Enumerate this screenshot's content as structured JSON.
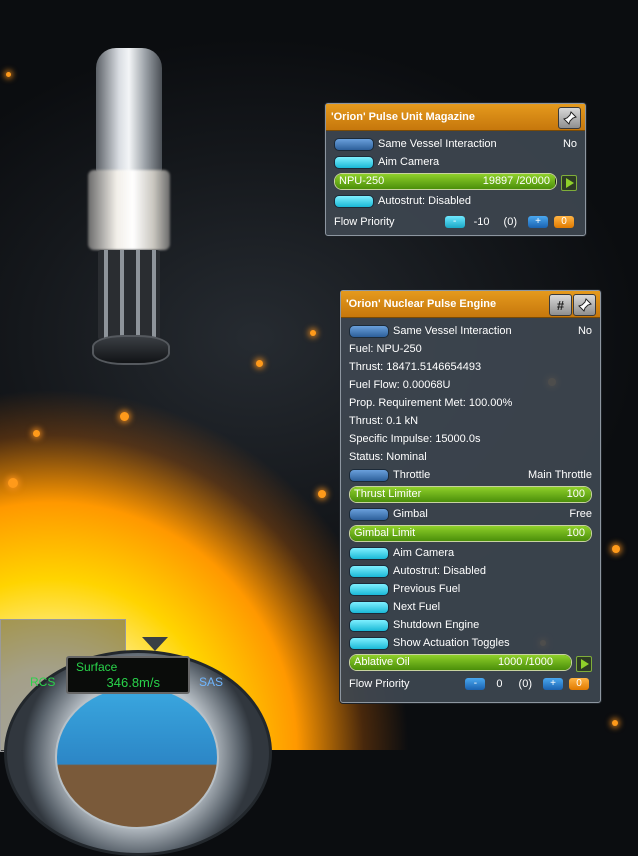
{
  "magazine": {
    "title": "'Orion' Pulse Unit Magazine",
    "pin_icon": "pin-icon",
    "same_vessel": {
      "label": "Same Vessel Interaction",
      "value": "No"
    },
    "aim_camera": "Aim Camera",
    "resource": {
      "name": "NPU-250",
      "amount": "19897 /20000",
      "fraction": 0.995
    },
    "autostrut": "Autostrut: Disabled",
    "flow": {
      "label": "Flow Priority",
      "minus": "-",
      "value": "-10",
      "paren": "(0)",
      "plus": "+",
      "zero": "0"
    }
  },
  "engine": {
    "title": "'Orion' Nuclear Pulse Engine",
    "hash_label": "#",
    "pin_icon": "pin-icon",
    "same_vessel": {
      "label": "Same Vessel Interaction",
      "value": "No"
    },
    "fuel": "Fuel: NPU-250",
    "thrust_exact": "Thrust: 18471.5146654493",
    "fuel_flow": "Fuel Flow: 0.00068U",
    "prop_req": "Prop. Requirement Met: 100.00%",
    "thrust": "Thrust: 0.1 kN",
    "isp": "Specific Impulse: 15000.0s",
    "status": "Status: Nominal",
    "throttle": {
      "label": "Throttle",
      "value": "Main Throttle"
    },
    "thrust_limiter": {
      "label": "Thrust Limiter",
      "value": "100",
      "fraction": 1.0
    },
    "gimbal": {
      "label": "Gimbal",
      "value": "Free"
    },
    "gimbal_limit": {
      "label": "Gimbal Limit",
      "value": "100",
      "fraction": 1.0
    },
    "actions": [
      "Aim Camera",
      "Autostrut: Disabled",
      "Previous Fuel",
      "Next Fuel",
      "Shutdown Engine",
      "Show Actuation Toggles"
    ],
    "resource": {
      "name": "Ablative Oil",
      "amount": "1000 /1000",
      "fraction": 1.0
    },
    "flow": {
      "label": "Flow Priority",
      "minus": "-",
      "value": "0",
      "paren": "(0)",
      "plus": "+",
      "zero": "0"
    }
  },
  "hud": {
    "mode": "Surface",
    "speed": "346.8m/s",
    "rcs": "RCS",
    "sas": "SAS"
  }
}
